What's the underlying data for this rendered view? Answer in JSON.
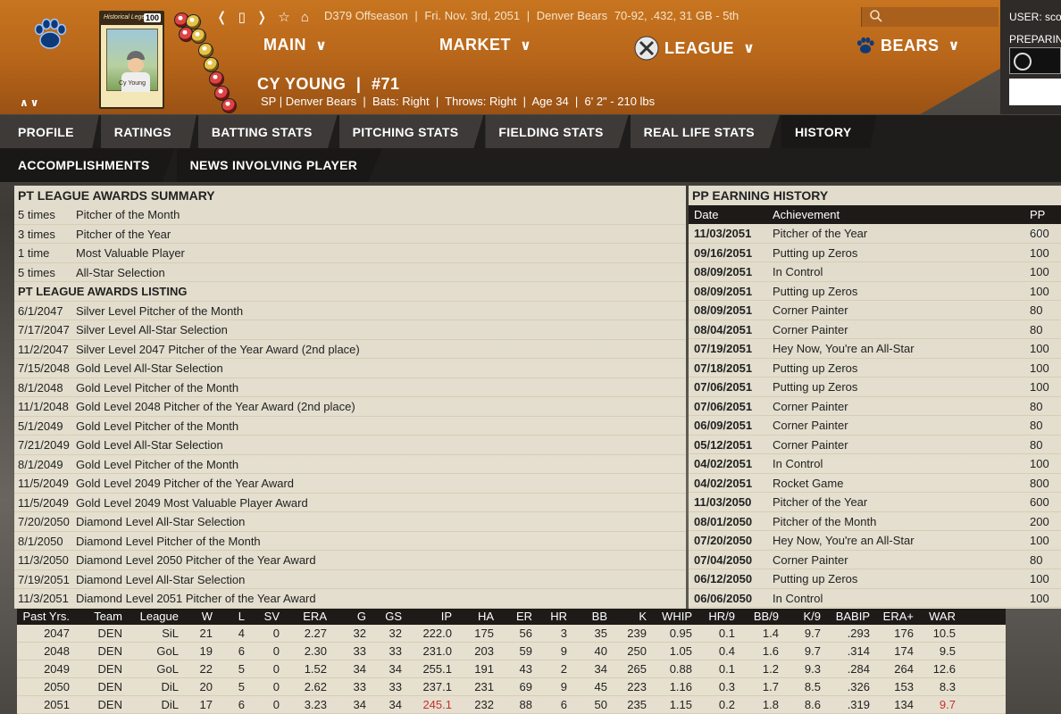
{
  "header": {
    "nav_info": [
      "D379 Offseason",
      "|",
      "Fri. Nov. 3rd, 2051",
      "|",
      "Denver Bears",
      "70-92, .432, 31 GB - 5th"
    ],
    "menus": [
      {
        "label": "MAIN",
        "icon": ""
      },
      {
        "label": "MARKET",
        "icon": ""
      },
      {
        "label": "LEAGUE",
        "icon": "league-logo-icon"
      },
      {
        "label": "BEARS",
        "icon": "paw-icon"
      }
    ],
    "card": {
      "top_text": "Historical Legends",
      "number": "100",
      "name_text": "Cy Young"
    },
    "user_label": "USER: sco",
    "user_status": "PREPARIN"
  },
  "player": {
    "name": "CY YOUNG",
    "sep": "|",
    "number": "#71",
    "info": "SP | Denver Bears  |  Bats: Right  |  Throws: Right  |  Age 34  |  6' 2\" - 210 lbs"
  },
  "tabs_row1": [
    "PROFILE",
    "RATINGS",
    "BATTING STATS",
    "PITCHING STATS",
    "FIELDING STATS",
    "REAL LIFE STATS",
    "HISTORY"
  ],
  "tabs_row2": [
    "ACCOMPLISHMENTS",
    "NEWS INVOLVING PLAYER"
  ],
  "awards_summary": {
    "title": "PT LEAGUE AWARDS SUMMARY",
    "rows": [
      {
        "count": "5 times",
        "award": "Pitcher of the Month"
      },
      {
        "count": "3 times",
        "award": "Pitcher of the Year"
      },
      {
        "count": "1 time",
        "award": "Most Valuable Player"
      },
      {
        "count": "5 times",
        "award": "All-Star Selection"
      }
    ]
  },
  "awards_listing": {
    "title": "PT LEAGUE AWARDS LISTING",
    "rows": [
      {
        "date": "6/1/2047",
        "award": "Silver Level Pitcher of the Month"
      },
      {
        "date": "7/17/2047",
        "award": "Silver Level All-Star Selection"
      },
      {
        "date": "11/2/2047",
        "award": "Silver Level 2047 Pitcher of the Year Award (2nd place)"
      },
      {
        "date": "7/15/2048",
        "award": "Gold Level All-Star Selection"
      },
      {
        "date": "8/1/2048",
        "award": "Gold Level Pitcher of the Month"
      },
      {
        "date": "11/1/2048",
        "award": "Gold Level 2048 Pitcher of the Year Award (2nd place)"
      },
      {
        "date": "5/1/2049",
        "award": "Gold Level Pitcher of the Month"
      },
      {
        "date": "7/21/2049",
        "award": "Gold Level All-Star Selection"
      },
      {
        "date": "8/1/2049",
        "award": "Gold Level Pitcher of the Month"
      },
      {
        "date": "11/5/2049",
        "award": "Gold Level 2049 Pitcher of the Year Award"
      },
      {
        "date": "11/5/2049",
        "award": "Gold Level 2049 Most Valuable Player Award"
      },
      {
        "date": "7/20/2050",
        "award": "Diamond Level All-Star Selection"
      },
      {
        "date": "8/1/2050",
        "award": "Diamond Level Pitcher of the Month"
      },
      {
        "date": "11/3/2050",
        "award": "Diamond Level 2050 Pitcher of the Year Award"
      },
      {
        "date": "7/19/2051",
        "award": "Diamond Level All-Star Selection"
      },
      {
        "date": "11/3/2051",
        "award": "Diamond Level 2051 Pitcher of the Year Award"
      }
    ]
  },
  "pp_history": {
    "title": "PP EARNING HISTORY",
    "headers": [
      "Date",
      "Achievement",
      "PP Pa"
    ],
    "rows": [
      {
        "date": "11/03/2051",
        "achievement": "Pitcher of the Year",
        "pp": "600"
      },
      {
        "date": "09/16/2051",
        "achievement": "Putting up Zeros",
        "pp": "100"
      },
      {
        "date": "08/09/2051",
        "achievement": "In Control",
        "pp": "100"
      },
      {
        "date": "08/09/2051",
        "achievement": "Putting up Zeros",
        "pp": "100"
      },
      {
        "date": "08/09/2051",
        "achievement": "Corner Painter",
        "pp": "80"
      },
      {
        "date": "08/04/2051",
        "achievement": "Corner Painter",
        "pp": "80"
      },
      {
        "date": "07/19/2051",
        "achievement": "Hey Now, You're an All-Star",
        "pp": "100"
      },
      {
        "date": "07/18/2051",
        "achievement": "Putting up Zeros",
        "pp": "100"
      },
      {
        "date": "07/06/2051",
        "achievement": "Putting up Zeros",
        "pp": "100"
      },
      {
        "date": "07/06/2051",
        "achievement": "Corner Painter",
        "pp": "80"
      },
      {
        "date": "06/09/2051",
        "achievement": "Corner Painter",
        "pp": "80"
      },
      {
        "date": "05/12/2051",
        "achievement": "Corner Painter",
        "pp": "80"
      },
      {
        "date": "04/02/2051",
        "achievement": "In Control",
        "pp": "100"
      },
      {
        "date": "04/02/2051",
        "achievement": "Rocket Game",
        "pp": "800"
      },
      {
        "date": "11/03/2050",
        "achievement": "Pitcher of the Year",
        "pp": "600"
      },
      {
        "date": "08/01/2050",
        "achievement": "Pitcher of the Month",
        "pp": "200"
      },
      {
        "date": "07/20/2050",
        "achievement": "Hey Now, You're an All-Star",
        "pp": "100"
      },
      {
        "date": "07/04/2050",
        "achievement": "Corner Painter",
        "pp": "80"
      },
      {
        "date": "06/12/2050",
        "achievement": "Putting up Zeros",
        "pp": "100"
      },
      {
        "date": "06/06/2050",
        "achievement": "In Control",
        "pp": "100"
      }
    ]
  },
  "past_stats": {
    "headers": [
      "Past Yrs.",
      "Team",
      "League",
      "W",
      "L",
      "SV",
      "ERA",
      "G",
      "GS",
      "IP",
      "HA",
      "ER",
      "HR",
      "BB",
      "K",
      "WHIP",
      "HR/9",
      "BB/9",
      "K/9",
      "BABIP",
      "ERA+",
      "WAR"
    ],
    "rows": [
      [
        "2047",
        "DEN",
        "SiL",
        "21",
        "4",
        "0",
        "2.27",
        "32",
        "32",
        "222.0",
        "175",
        "56",
        "3",
        "35",
        "239",
        "0.95",
        "0.1",
        "1.4",
        "9.7",
        ".293",
        "176",
        "10.5"
      ],
      [
        "2048",
        "DEN",
        "GoL",
        "19",
        "6",
        "0",
        "2.30",
        "33",
        "33",
        "231.0",
        "203",
        "59",
        "9",
        "40",
        "250",
        "1.05",
        "0.4",
        "1.6",
        "9.7",
        ".314",
        "174",
        "9.5"
      ],
      [
        "2049",
        "DEN",
        "GoL",
        "22",
        "5",
        "0",
        "1.52",
        "34",
        "34",
        "255.1",
        "191",
        "43",
        "2",
        "34",
        "265",
        "0.88",
        "0.1",
        "1.2",
        "9.3",
        ".284",
        "264",
        "12.6"
      ],
      [
        "2050",
        "DEN",
        "DiL",
        "20",
        "5",
        "0",
        "2.62",
        "33",
        "33",
        "237.1",
        "231",
        "69",
        "9",
        "45",
        "223",
        "1.16",
        "0.3",
        "1.7",
        "8.5",
        ".326",
        "153",
        "8.3"
      ],
      [
        "2051",
        "DEN",
        "DiL",
        "17",
        "6",
        "0",
        "3.23",
        "34",
        "34",
        "245.1",
        "232",
        "88",
        "6",
        "50",
        "235",
        "1.15",
        "0.2",
        "1.8",
        "8.6",
        ".319",
        "134",
        "9.7"
      ]
    ],
    "highlight_color": "#c43030"
  }
}
